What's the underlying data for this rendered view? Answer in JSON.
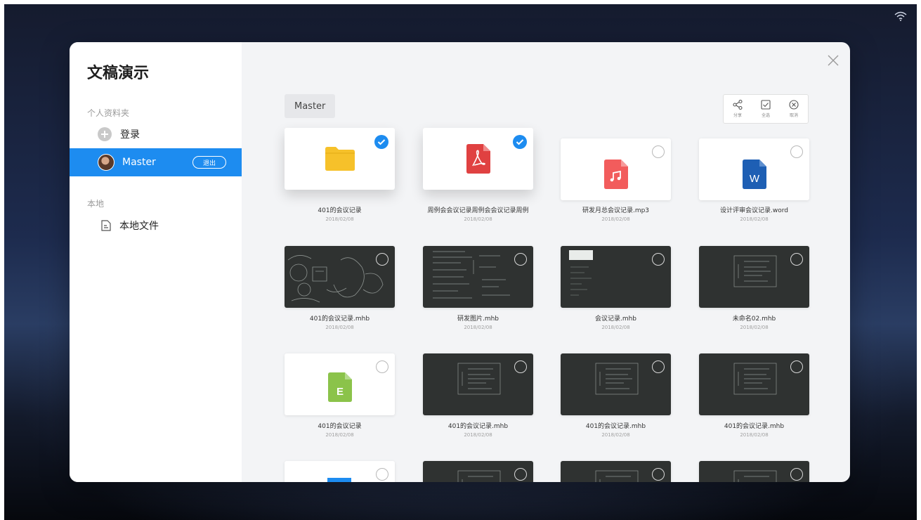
{
  "app": {
    "title": "文稿演示"
  },
  "sidebar": {
    "personal_section_label": "个人资料夹",
    "login_label": "登录",
    "user": {
      "name": "Master",
      "logout_label": "退出"
    },
    "local_section_label": "本地",
    "local_files_label": "本地文件"
  },
  "breadcrumb": {
    "current": "Master"
  },
  "toolbar": {
    "share_label": "分享",
    "select_all_label": "全选",
    "cancel_label": "取消"
  },
  "files": [
    {
      "name": "401的会议记录",
      "date": "2018/02/08",
      "kind": "folder",
      "selected": true
    },
    {
      "name": "周例会会议记录周例会会议记录周例",
      "date": "2018/02/08",
      "kind": "pdf",
      "selected": true
    },
    {
      "name": "研发月总会议记录.mp3",
      "date": "2018/02/08",
      "kind": "music",
      "selected": false
    },
    {
      "name": "设计评审会议记录.word",
      "date": "2018/02/08",
      "kind": "word",
      "selected": false
    },
    {
      "name": "401的会议记录.mhb",
      "date": "2018/02/08",
      "kind": "board",
      "selected": false
    },
    {
      "name": "研发图片.mhb",
      "date": "2018/02/08",
      "kind": "board",
      "selected": false
    },
    {
      "name": "会议记录.mhb",
      "date": "2018/02/08",
      "kind": "board",
      "selected": false
    },
    {
      "name": "未命名02.mhb",
      "date": "2018/02/08",
      "kind": "board",
      "selected": false
    },
    {
      "name": "401的会议记录",
      "date": "2018/02/08",
      "kind": "excel",
      "selected": false
    },
    {
      "name": "401的会议记录.mhb",
      "date": "2018/02/08",
      "kind": "board",
      "selected": false
    },
    {
      "name": "401的会议记录.mhb",
      "date": "2018/02/08",
      "kind": "board",
      "selected": false
    },
    {
      "name": "401的会议记录.mhb",
      "date": "2018/02/08",
      "kind": "board",
      "selected": false
    },
    {
      "name": "",
      "date": "",
      "kind": "doc",
      "selected": false
    },
    {
      "name": "",
      "date": "",
      "kind": "board",
      "selected": false
    },
    {
      "name": "",
      "date": "",
      "kind": "board",
      "selected": false
    },
    {
      "name": "",
      "date": "",
      "kind": "board",
      "selected": false
    }
  ],
  "colors": {
    "accent": "#1d8cf0",
    "folder": "#f6c12a",
    "pdf": "#e04141",
    "music": "#f25c5c",
    "word": "#1e5fb4",
    "excel": "#8bc34a",
    "board": "#2f3231"
  },
  "icons": {
    "share": "share-icon",
    "select_all": "checkbox-icon",
    "cancel": "cancel-icon",
    "close": "close-icon",
    "wifi": "wifi-icon"
  }
}
